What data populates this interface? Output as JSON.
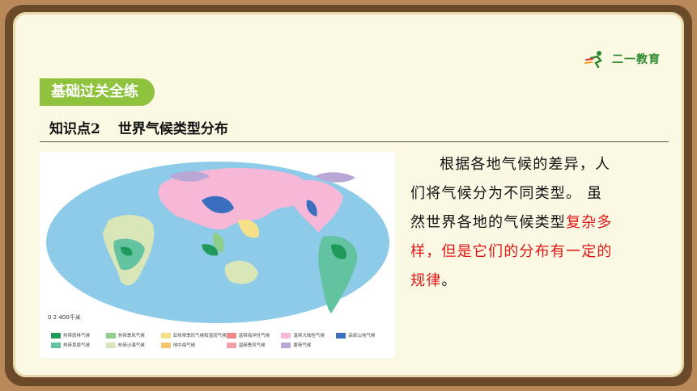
{
  "logo": {
    "text": "二一教育",
    "icon": "running-person-icon"
  },
  "section": {
    "badge": "基础过关全练"
  },
  "topic": {
    "number": "知识点2",
    "title": "世界气候类型分布"
  },
  "map": {
    "scale_label": "0   2 400千米",
    "legend": [
      {
        "label": "热带雨林气候",
        "color": "#1f9a5a"
      },
      {
        "label": "热带季风气候",
        "color": "#8fce8a"
      },
      {
        "label": "亚热带季风气候和湿润气候",
        "color": "#f6e08a"
      },
      {
        "label": "温带海洋性气候",
        "color": "#f08a8a"
      },
      {
        "label": "温带大陆性气候",
        "color": "#f7b7d6"
      },
      {
        "label": "高原山地气候",
        "color": "#3a6fc0"
      },
      {
        "label": "热带草原气候",
        "color": "#63c2a0"
      },
      {
        "label": "热带沙漠气候",
        "color": "#d9e7b8"
      },
      {
        "label": "地中海气候",
        "color": "#f4c36b"
      },
      {
        "label": "温带季风气候",
        "color": "#f4a0a8"
      },
      {
        "label": "寒带气候",
        "color": "#b9a8d6"
      }
    ],
    "ocean_color": "#8ecbe8"
  },
  "paragraph": {
    "line1": "根据各地气候的差异，人",
    "line2": "们将气候分为不同类型。 虽",
    "line3_a": "然世界各地的气候类型",
    "line3_hl": "复杂多",
    "line4_hl": "样，但是它们的分布有一定的",
    "line5_hl": "规律",
    "line5_end": "。"
  }
}
